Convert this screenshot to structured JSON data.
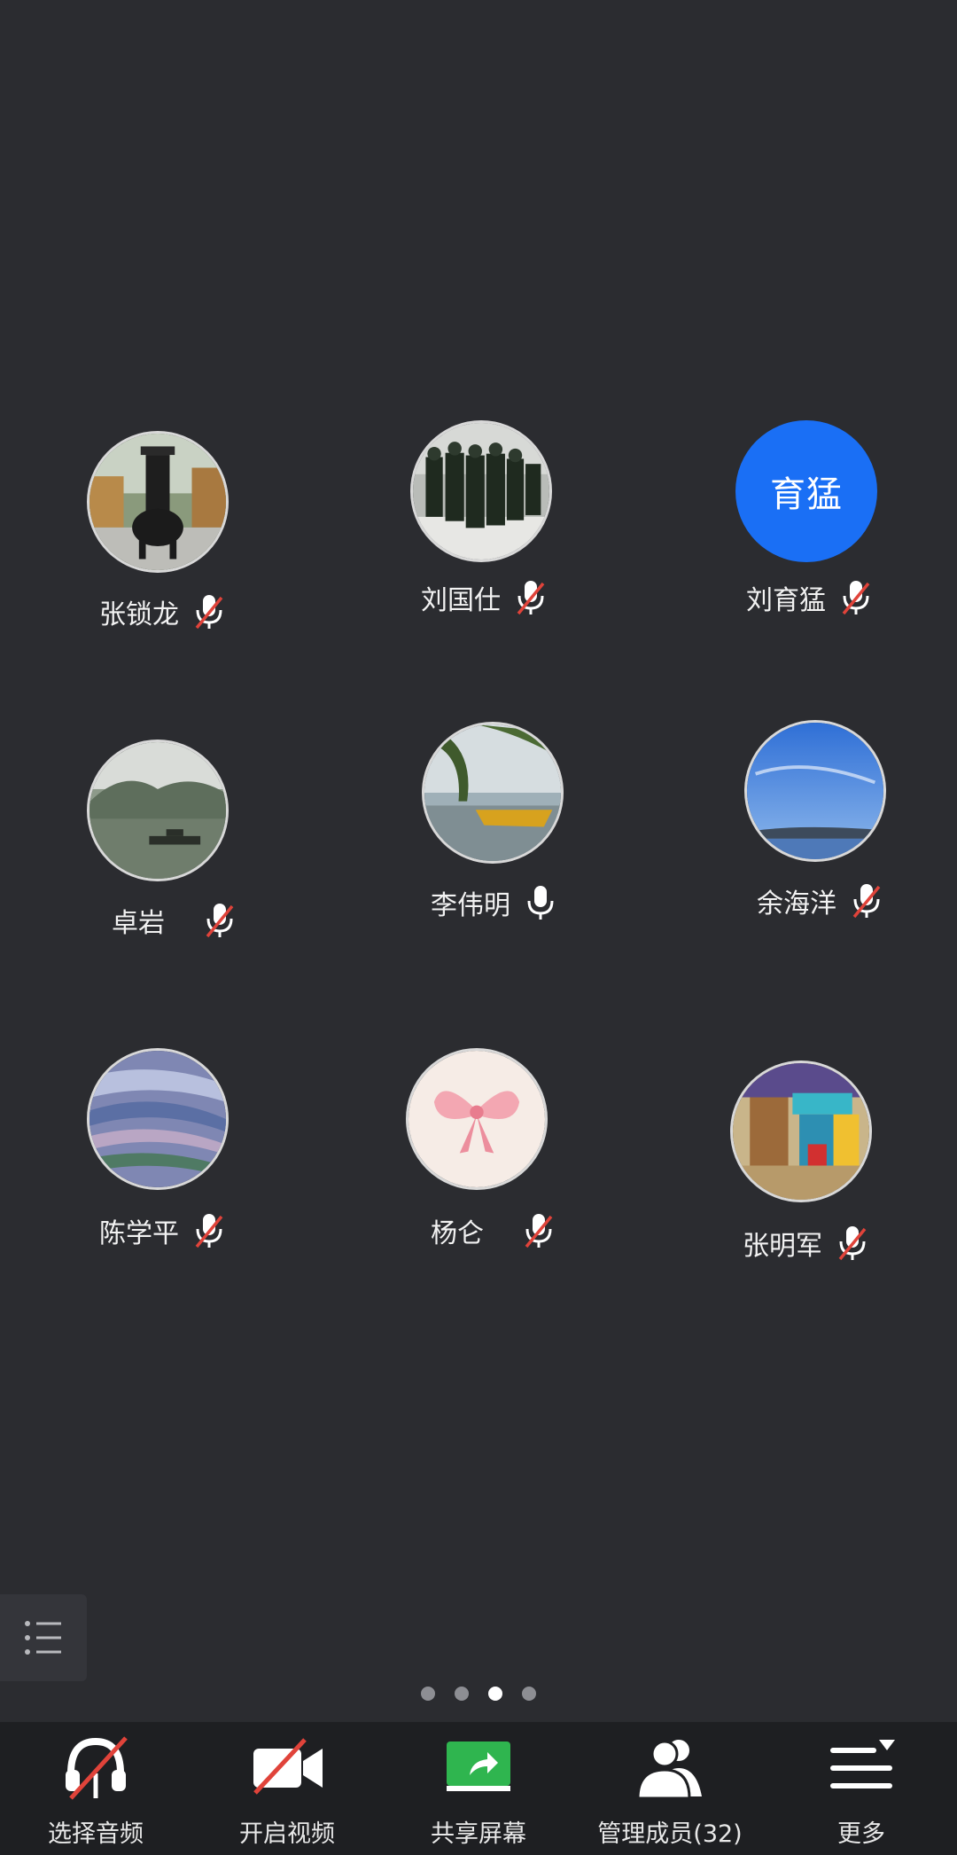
{
  "participants": [
    {
      "name": "张锁龙",
      "muted": true,
      "avatar": "photo-incense-burner"
    },
    {
      "name": "刘国仕",
      "muted": true,
      "avatar": "photo-soldiers"
    },
    {
      "name": "刘育猛",
      "muted": true,
      "avatar_text": "育猛",
      "avatar_color": "#1a6ff5"
    },
    {
      "name": "卓岩",
      "muted": true,
      "avatar": "photo-misty-lake"
    },
    {
      "name": "李伟明",
      "muted": false,
      "avatar": "photo-willow-boat"
    },
    {
      "name": "余海洋",
      "muted": true,
      "avatar": "photo-blue-sky"
    },
    {
      "name": "陈学平",
      "muted": true,
      "avatar": "photo-rice-terraces"
    },
    {
      "name": "杨仑",
      "muted": true,
      "avatar": "photo-pink-bow"
    },
    {
      "name": "张明军",
      "muted": true,
      "avatar": "photo-colorful-street"
    }
  ],
  "pagination": {
    "total": 4,
    "active_index": 3
  },
  "toolbar": {
    "audio_label": "选择音频",
    "video_label": "开启视频",
    "share_label": "共享屏幕",
    "members_label": "管理成员(32)",
    "more_label": "更多"
  },
  "colors": {
    "background": "#2b2c30",
    "toolbar_bg": "#1e1f22",
    "mute_red": "#e0433a",
    "share_green": "#2fb54f",
    "avatar_blue": "#1a6ff5"
  }
}
